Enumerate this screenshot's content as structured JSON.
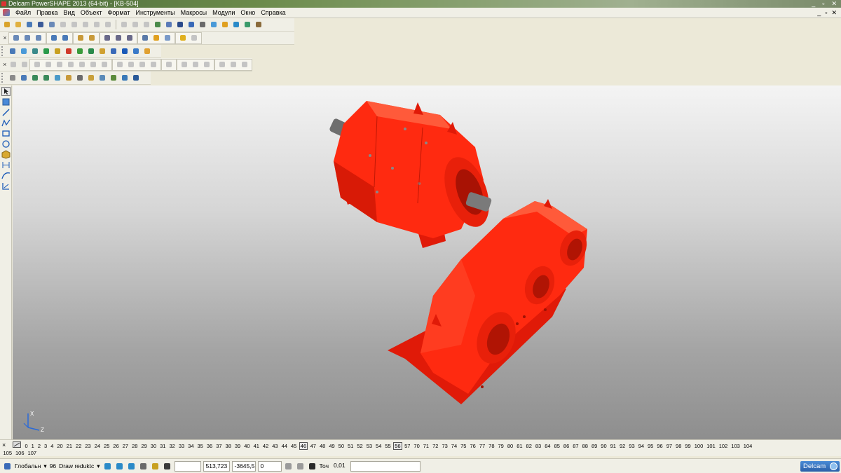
{
  "window": {
    "title": "Delcam PowerSHAPE 2013 (64-bit) - [KB-504]",
    "controls": [
      "_",
      "▫",
      "✕"
    ]
  },
  "menu": {
    "items": [
      "Файл",
      "Правка",
      "Вид",
      "Объект",
      "Формат",
      "Инструменты",
      "Макросы",
      "Модули",
      "Окно",
      "Справка"
    ],
    "mdi_controls": [
      "_",
      "▫",
      "✕"
    ]
  },
  "toolbars": {
    "close_glyph": "×"
  },
  "viewport": {
    "model_color": "#ff2a10",
    "shaft_color": "#7a7a7a",
    "triad": {
      "x_label": "X",
      "z_label": "Z"
    }
  },
  "levels": {
    "row1": [
      "0",
      "1",
      "2",
      "3",
      "4",
      "20",
      "21",
      "22",
      "23",
      "24",
      "25",
      "26",
      "27",
      "28",
      "29",
      "30",
      "31",
      "32",
      "33",
      "34",
      "35",
      "36",
      "37",
      "38",
      "39",
      "40",
      "41",
      "42",
      "43",
      "44",
      "45",
      "46",
      "47",
      "48",
      "49",
      "50",
      "51",
      "52",
      "53",
      "54",
      "55",
      "56",
      "57",
      "70",
      "71",
      "72",
      "73",
      "74",
      "75",
      "76",
      "77",
      "78",
      "79",
      "80",
      "81",
      "82",
      "83",
      "84",
      "85",
      "86",
      "87",
      "88",
      "89",
      "90",
      "91",
      "92",
      "93",
      "94",
      "95",
      "96",
      "97",
      "98",
      "99",
      "100",
      "101",
      "102",
      "103",
      "104"
    ],
    "row2": [
      "105",
      "106",
      "107"
    ],
    "boxed": [
      "46",
      "56"
    ]
  },
  "status": {
    "workplane": "Глобальн",
    "level_number": "96",
    "level_name": "Draw reduktc",
    "coord_x": "513,723",
    "coord_y": "-3645,5",
    "coord_z": "0",
    "snap_label": "Точ",
    "tolerance": "0,01",
    "brand": "Delcam"
  }
}
